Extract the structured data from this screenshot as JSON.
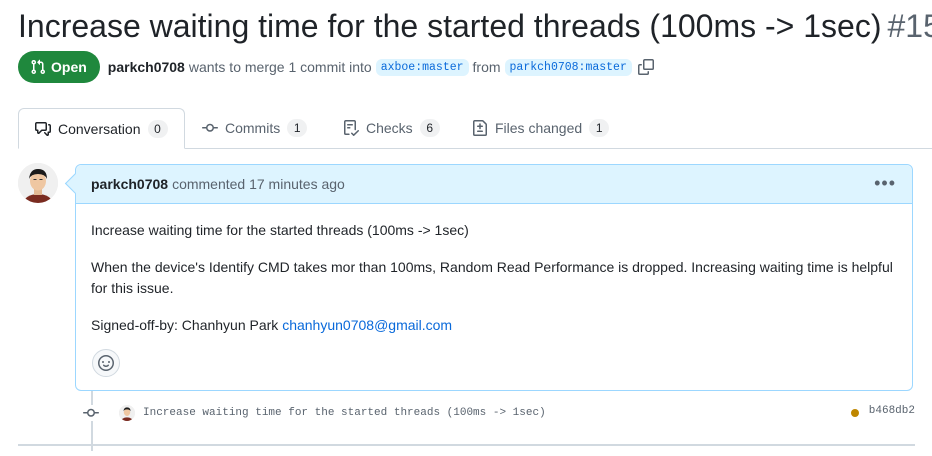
{
  "pr": {
    "title": "Increase waiting time for the started threads (100ms -> 1sec)",
    "number": "#15"
  },
  "meta": {
    "state": "Open",
    "author": "parkch0708",
    "text_merge": "wants to merge 1 commit into",
    "base_branch": "axboe:master",
    "text_from": "from",
    "head_branch": "parkch0708:master"
  },
  "tabs": [
    {
      "label": "Conversation",
      "count": "0",
      "icon": "comment-discussion-icon"
    },
    {
      "label": "Commits",
      "count": "1",
      "icon": "git-commit-icon"
    },
    {
      "label": "Checks",
      "count": "6",
      "icon": "checklist-icon"
    },
    {
      "label": "Files changed",
      "count": "1",
      "icon": "file-diff-icon"
    }
  ],
  "comment": {
    "author": "parkch0708",
    "action": "commented 17 minutes ago",
    "paragraphs": [
      "Increase waiting time for the started threads (100ms -> 1sec)",
      "When the device's Identify CMD takes mor than 100ms, Random Read Performance is dropped. Increasing waiting time is helpful for this issue."
    ],
    "signoff_prefix": "Signed-off-by: Chanhyun Park",
    "signoff_email": "chanhyun0708@gmail.com"
  },
  "commit": {
    "message": "Increase waiting time for the started threads (100ms -> 1sec)",
    "sha": "b468db2",
    "status_color": "#bf8700"
  },
  "colors": {
    "open_green": "#1f883d",
    "link_blue": "#0969da",
    "header_blue": "#ddf4ff"
  }
}
